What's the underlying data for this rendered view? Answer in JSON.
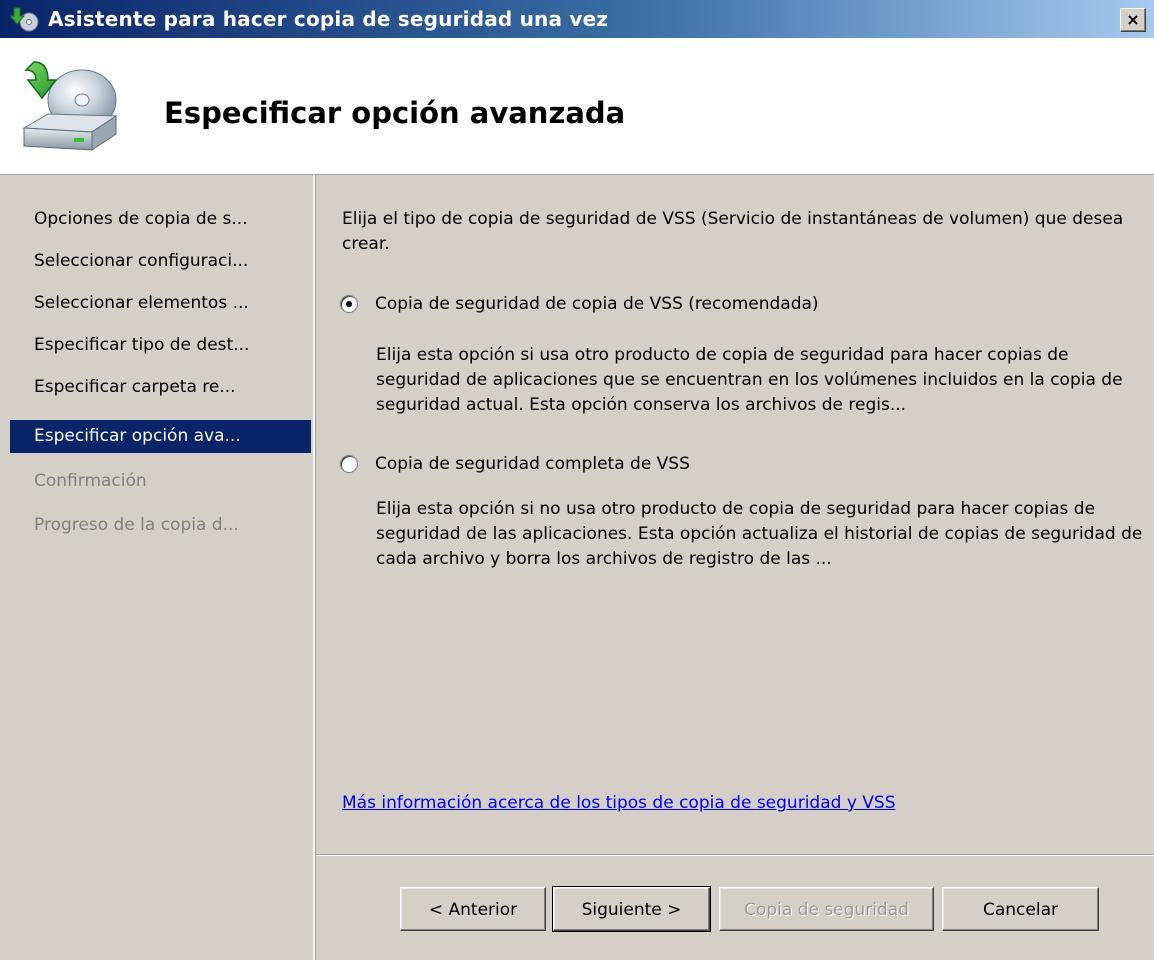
{
  "window": {
    "title": "Asistente para hacer copia de seguridad una vez",
    "close_label": "×"
  },
  "header": {
    "title": "Especificar opción avanzada"
  },
  "sidebar": {
    "items": [
      {
        "label": "Opciones de copia de s..."
      },
      {
        "label": "Seleccionar configuraci..."
      },
      {
        "label": "Seleccionar elementos ..."
      },
      {
        "label": "Especificar tipo de dest..."
      },
      {
        "label": "Especificar carpeta re..."
      },
      {
        "label": "Especificar opción ava..."
      },
      {
        "label": "Confirmación"
      },
      {
        "label": "Progreso de la copia d..."
      }
    ]
  },
  "main": {
    "intro": "Elija el tipo de copia de seguridad de VSS (Servicio de instantáneas de volumen) que desea crear.",
    "options": [
      {
        "label": "Copia de seguridad de copia de VSS (recomendada)",
        "selected": true,
        "description": "Elija esta opción si usa otro producto de copia de seguridad para hacer copias de seguridad de aplicaciones que se encuentran en los volúmenes incluidos en la copia de seguridad actual. Esta opción conserva los archivos de regis..."
      },
      {
        "label": "Copia de seguridad completa de VSS",
        "selected": false,
        "description": "Elija esta opción si no usa otro producto de copia de seguridad para hacer copias de seguridad de las aplicaciones. Esta opción actualiza el historial de copias de seguridad de cada archivo y borra los archivos de registro de las ..."
      }
    ],
    "more_info_link": "Más información acerca de los tipos de copia de seguridad y VSS"
  },
  "footer": {
    "back": "< Anterior",
    "next": "Siguiente >",
    "backup": "Copia de seguridad",
    "cancel": "Cancelar"
  }
}
